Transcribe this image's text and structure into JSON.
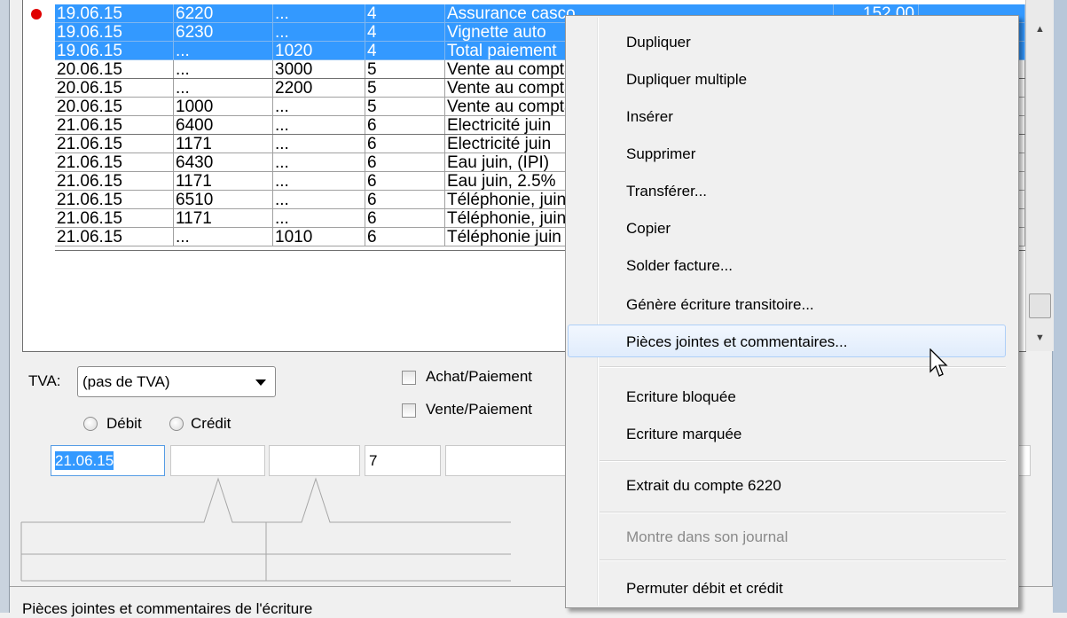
{
  "grid": {
    "rows": [
      {
        "date": "19.06.15",
        "debit": "6220",
        "credit": "...",
        "piece": "4",
        "libelle": "Assurance casco",
        "montant": "152.00",
        "selected": true,
        "marker": true
      },
      {
        "date": "19.06.15",
        "debit": "6230",
        "credit": "...",
        "piece": "4",
        "libelle": "Vignette auto",
        "montant": "",
        "selected": true
      },
      {
        "date": "19.06.15",
        "debit": "...",
        "credit": "1020",
        "piece": "4",
        "libelle": "Total paiement",
        "montant": "",
        "selected": true
      },
      {
        "date": "20.06.15",
        "debit": "...",
        "credit": "3000",
        "piece": "5",
        "libelle": "Vente au comptant",
        "montant": ""
      },
      {
        "date": "20.06.15",
        "debit": "...",
        "credit": "2200",
        "piece": "5",
        "libelle": "Vente au comptant",
        "montant": ""
      },
      {
        "date": "20.06.15",
        "debit": "1000",
        "credit": "...",
        "piece": "5",
        "libelle": "Vente au comptant",
        "montant": ""
      },
      {
        "date": "21.06.15",
        "debit": "6400",
        "credit": "...",
        "piece": "6",
        "libelle": "Electricité juin",
        "montant": ""
      },
      {
        "date": "21.06.15",
        "debit": "1171",
        "credit": "...",
        "piece": "6",
        "libelle": "Electricité juin",
        "montant": ""
      },
      {
        "date": "21.06.15",
        "debit": "6430",
        "credit": "...",
        "piece": "6",
        "libelle": "Eau juin, (IPI)",
        "montant": ""
      },
      {
        "date": "21.06.15",
        "debit": "1171",
        "credit": "...",
        "piece": "6",
        "libelle": "Eau juin, 2.5%",
        "montant": ""
      },
      {
        "date": "21.06.15",
        "debit": "6510",
        "credit": "...",
        "piece": "6",
        "libelle": "Téléphonie, juin",
        "montant": ""
      },
      {
        "date": "21.06.15",
        "debit": "1171",
        "credit": "...",
        "piece": "6",
        "libelle": "Téléphonie, juin",
        "montant": ""
      },
      {
        "date": "21.06.15",
        "debit": "...",
        "credit": "1010",
        "piece": "6",
        "libelle": "Téléphonie juin",
        "montant": ""
      }
    ]
  },
  "editor": {
    "tva_label": "TVA:",
    "tva_value": "(pas de TVA)",
    "debit_label": "Débit",
    "credit_label": "Crédit",
    "achat_label": "Achat/Paiement",
    "vente_label": "Vente/Paiement",
    "date_value": "21.06.15",
    "piece_value": "7"
  },
  "status": {
    "text": "Pièces jointes et commentaires de l'écriture"
  },
  "menu": {
    "items": [
      {
        "label": "Dupliquer"
      },
      {
        "label": "Dupliquer multiple"
      },
      {
        "label": "Insérer"
      },
      {
        "label": "Supprimer"
      },
      {
        "label": "Transférer..."
      },
      {
        "label": "Copier"
      },
      {
        "label": "Solder facture..."
      },
      {
        "label": "Génère écriture transitoire..."
      },
      {
        "label": "Pièces jointes et commentaires...",
        "hover": true
      },
      {
        "label": "Ecriture bloquée"
      },
      {
        "label": "Ecriture marquée"
      },
      {
        "label": "Extrait du compte 6220"
      },
      {
        "label": "Montre dans son journal",
        "disabled": true
      },
      {
        "label": "Permuter débit et crédit"
      }
    ]
  },
  "colors": {
    "selection": "#3399ff",
    "marker": "#e00000",
    "menu_hover_border": "#aecff7"
  }
}
